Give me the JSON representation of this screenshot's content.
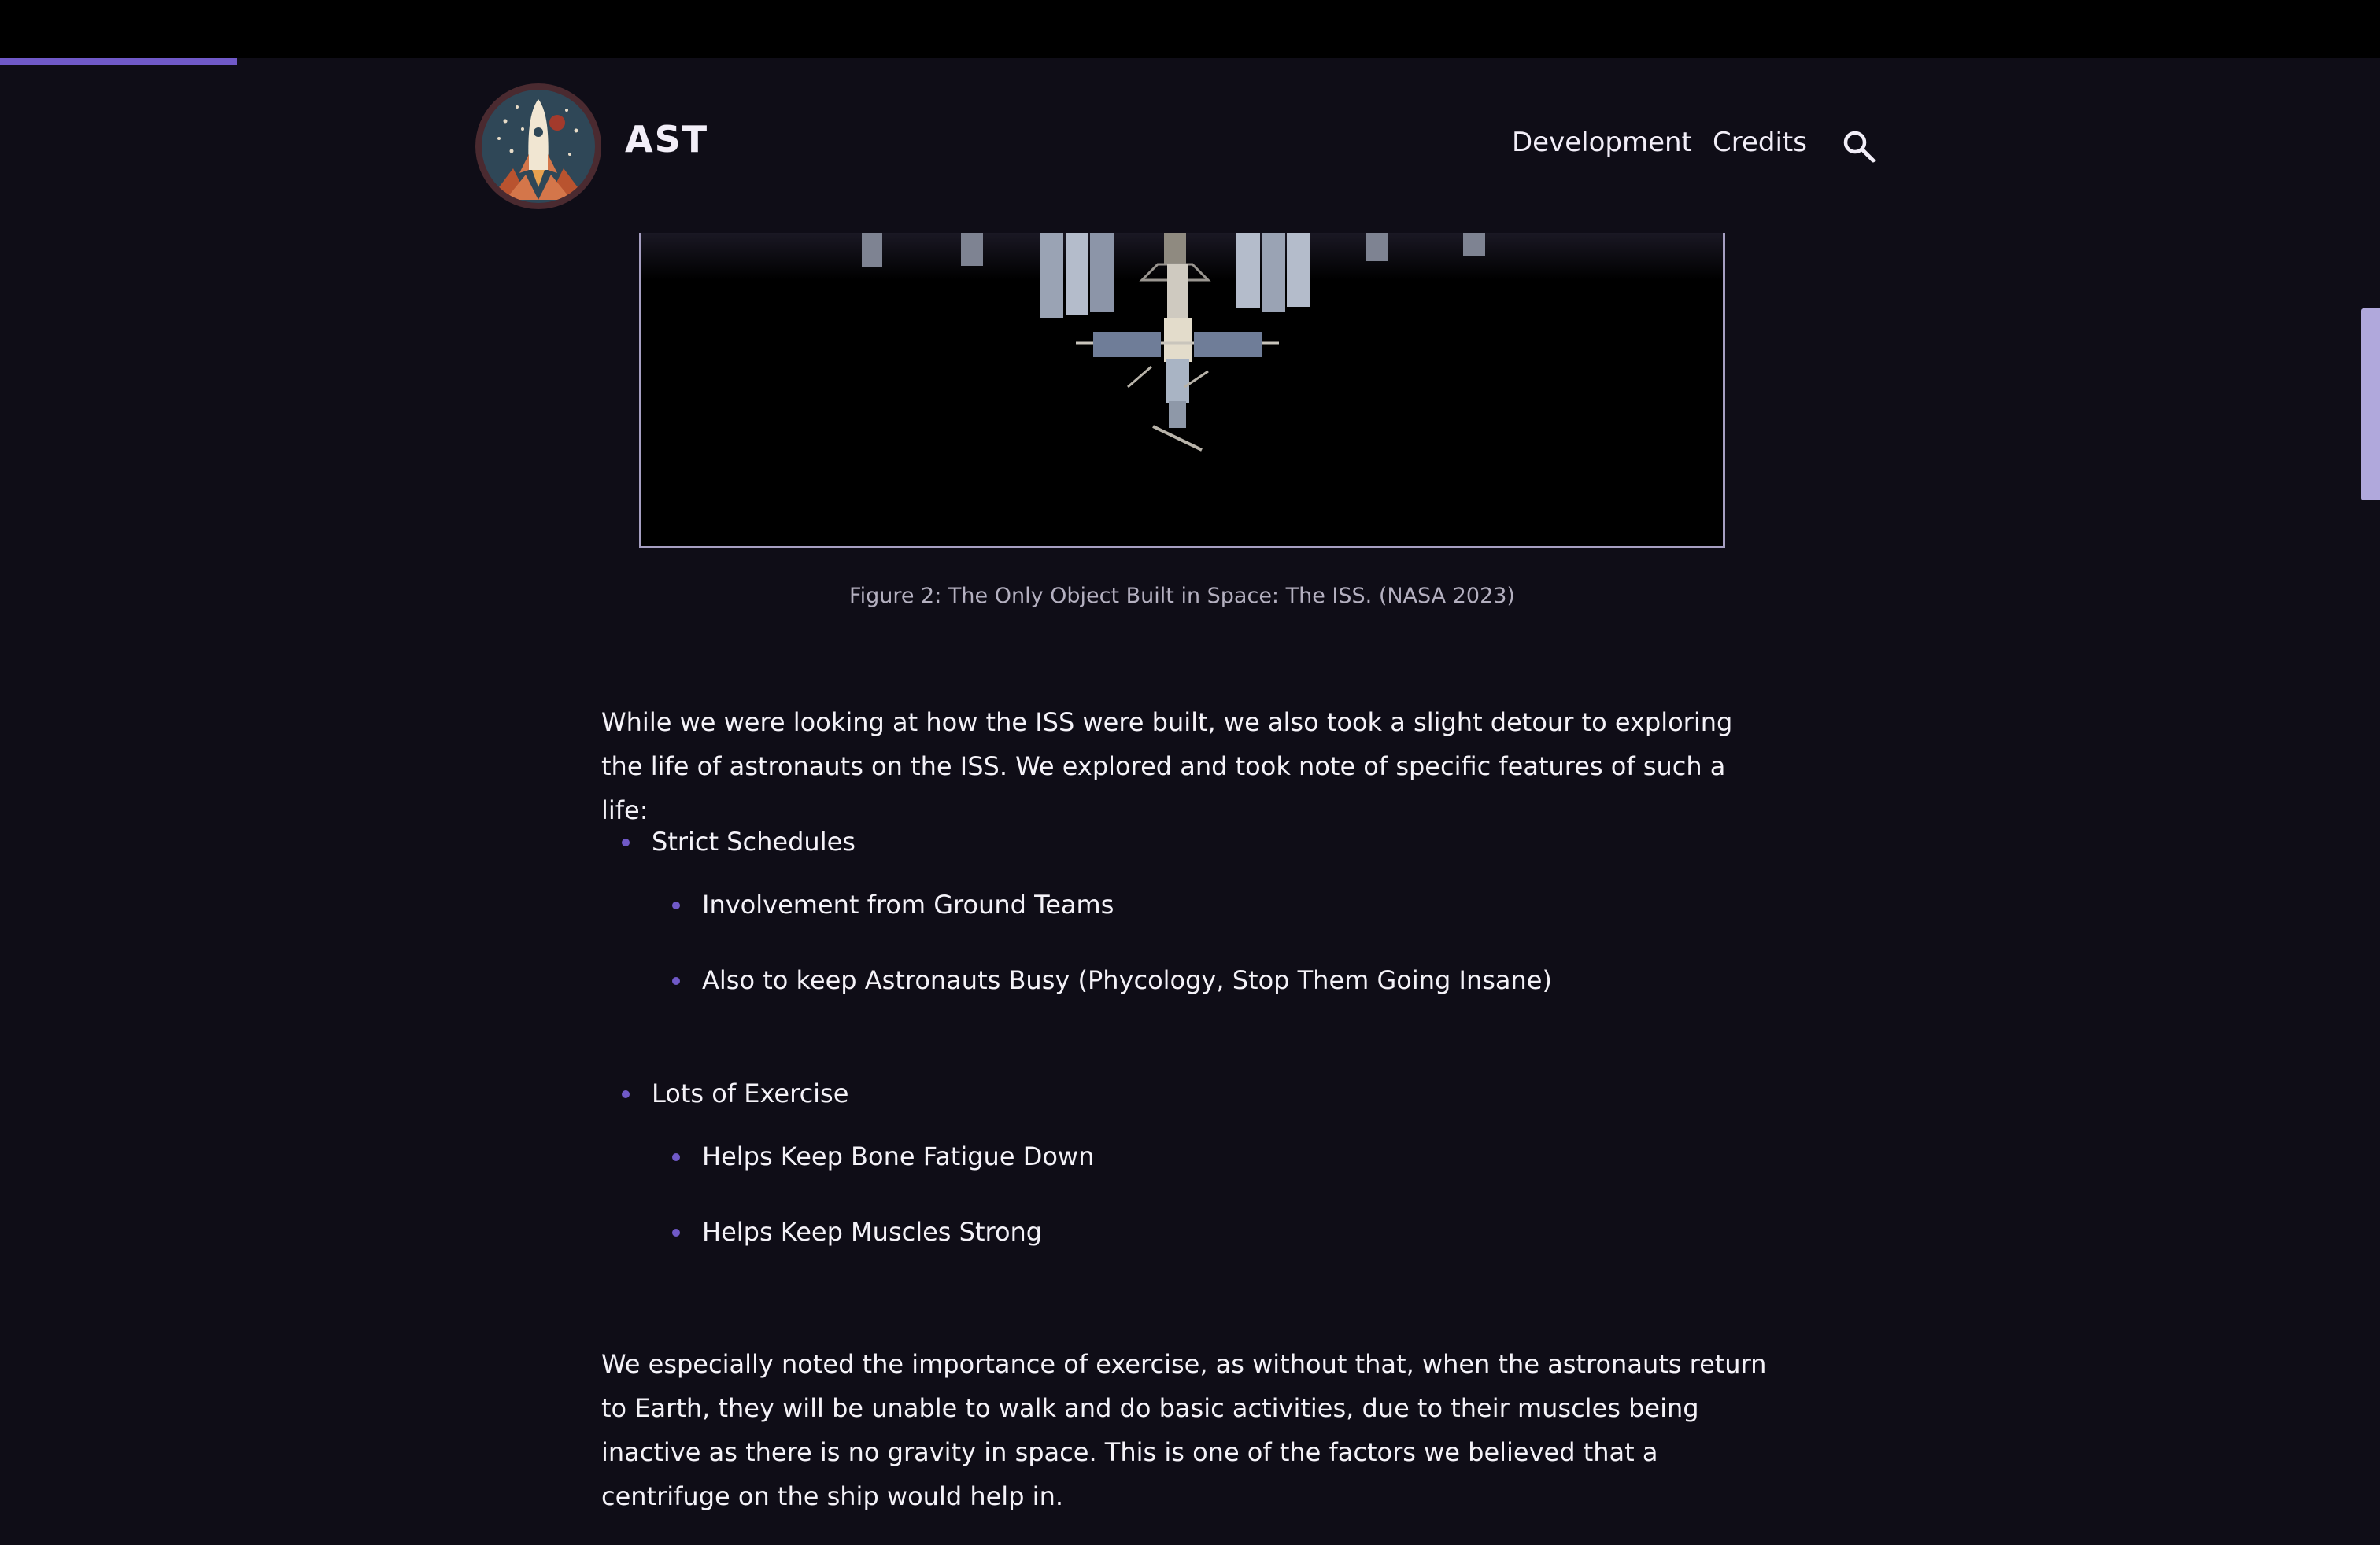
{
  "reading_progress": 0.0995,
  "header": {
    "site_title": "AST",
    "nav": {
      "development": "Development",
      "credits": "Credits"
    }
  },
  "figure": {
    "caption": "Figure 2: The Only Object Built in Space: The ISS. (NASA 2023)"
  },
  "article": {
    "intro": "While we were looking at how the ISS were built, we also took a slight detour to exploring the life of astronauts on the ISS. We explored and took note of specific features of such a life:",
    "list": [
      {
        "label": "Strict Schedules",
        "children": [
          "Involvement from Ground Teams",
          "Also to keep Astronauts Busy (Phycology, Stop Them Going Insane)"
        ]
      },
      {
        "label": "Lots of Exercise",
        "children": [
          "Helps Keep Bone Fatigue Down",
          "Helps Keep Muscles Strong"
        ]
      }
    ],
    "conclusion": "We especially noted the importance of exercise, as without that, when the astronauts return to Earth, they will be unable to walk and do basic activities, due to their muscles being inactive as there is no gravity in space. This is one of the factors we believed that a centrifuge on the ship would help in."
  },
  "colors": {
    "background": "#0f0d17",
    "accent": "#7059c8",
    "frame_border": "#a69fc2",
    "scrollbar": "#b0a8dc"
  },
  "icons": [
    "rocket-logo-icon",
    "search-icon"
  ]
}
